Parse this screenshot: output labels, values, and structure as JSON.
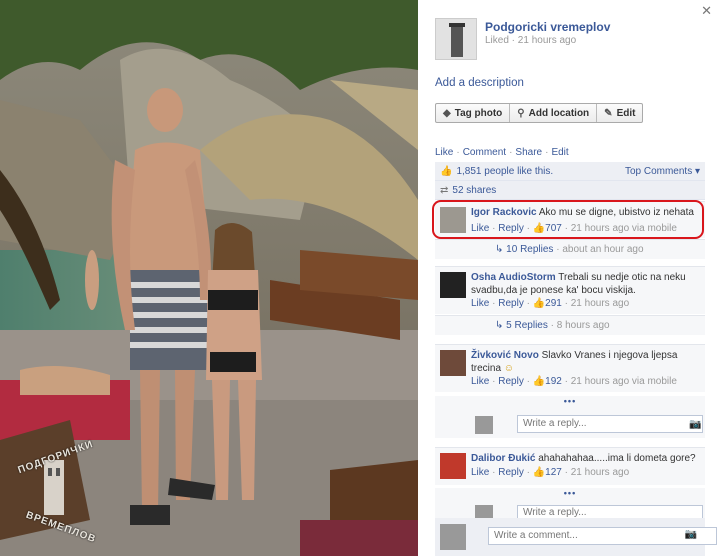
{
  "photo": {
    "watermark_top": "ПОДГОРИЧКИ",
    "watermark_bottom": "ВРЕМЕПЛОВ"
  },
  "close_label": "✕",
  "page": {
    "name": "Podgoricki vremeplov",
    "liked": "Liked",
    "time": "21 hours ago",
    "description_link": "Add a description"
  },
  "buttons": {
    "tag": "Tag photo",
    "location": "Add location",
    "edit": "Edit"
  },
  "actions": [
    "Like",
    "Comment",
    "Share",
    "Edit"
  ],
  "likes_text": "1,851 people like this.",
  "top_comments": "Top Comments ▾",
  "shares_text": "52 shares",
  "comments": [
    {
      "name": "Igor Rackovic",
      "text": "Ako mu se digne, ubistvo iz nehata",
      "like": "Like",
      "reply": "Reply",
      "count": "707",
      "time": "21 hours ago via mobile",
      "replies": "10 Replies",
      "replies_time": "about an hour ago"
    },
    {
      "name": "Osha AudioStorm",
      "text": "Trebali su nedje otic na neku svadbu,da je ponese ka' bocu viskija.",
      "like": "Like",
      "reply": "Reply",
      "count": "291",
      "time": "21 hours ago",
      "replies": "5 Replies",
      "replies_time": "8 hours ago"
    },
    {
      "name": "Živković Novo",
      "text": "Slavko Vranes i njegova ljepsa trecina",
      "like": "Like",
      "reply": "Reply",
      "count": "192",
      "time": "21 hours ago via mobile"
    },
    {
      "name": "Dalibor Đukić",
      "text": "ahahahahaa.....ima li dometa gore?",
      "like": "Like",
      "reply": "Reply",
      "count": "127",
      "time": "21 hours ago"
    }
  ],
  "more_label": "•••",
  "write_reply": "Write a reply...",
  "write_comment": "Write a comment..."
}
